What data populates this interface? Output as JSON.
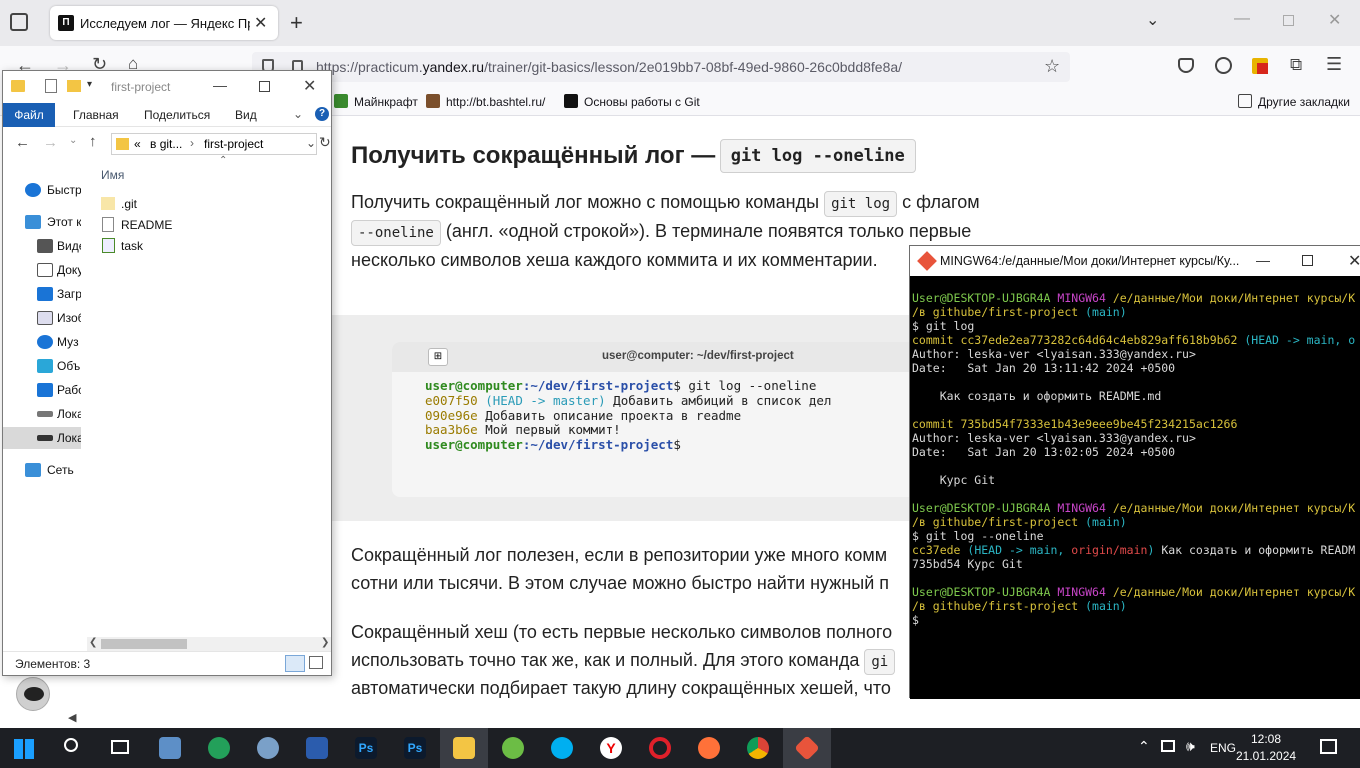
{
  "browser": {
    "tab_title": "Исследуем лог — Яндекс Практ",
    "url_prefix": "https://practicum.",
    "url_host": "yandex.ru",
    "url_path": "/trainer/git-basics/lesson/2e019bb7-08bf-49ed-9860-26c0bdd8fe8a/",
    "bookmarks": [
      "Майнкрафт",
      "http://bt.bashtel.ru/",
      "Основы работы с Git"
    ],
    "other_bookmarks": "Другие закладки"
  },
  "lesson": {
    "heading": "Получить сокращённый лог —",
    "heading_code": "git log --oneline",
    "p1_a": "Получить сокращённый лог можно с помощью команды",
    "p1_code1": "git log",
    "p1_b": "с флагом",
    "p1_code2": "--oneline",
    "p1_c": "(англ. «одной строкой»). В терминале появятся только первые",
    "p1_d": "несколько символов хеша каждого коммита и их комментарии.",
    "terminal_title": "user@computer: ~/dev/first-project",
    "term_prompt_user": "user@computer",
    "term_prompt_path": ":~/dev/first-project",
    "term_cmd": "$ git log --oneline",
    "term_l1_hash": "e007f50",
    "term_l1_ref": "(HEAD -> master)",
    "term_l1_msg": "Добавить амбиций в список дел",
    "term_l2_hash": "090e96e",
    "term_l2_msg": "Добавить описание проекта в readme",
    "term_l3_hash": "baa3b6e",
    "term_l3_msg": "Мой первый коммит!",
    "term_end": "$",
    "p2_a": "Сокращённый лог полезен, если в репозитории уже много комм",
    "p2_b": "сотни или тысячи. В этом случае можно быстро найти нужный п",
    "p3_a": "Сокращённый хеш (то есть первые несколько символов полного",
    "p3_b": "использовать точно так же, как и полный. Для этого команда",
    "p3_b_code": "gi",
    "p3_c": "автоматически подбирает такую длину сокращённых хешей, что"
  },
  "explorer": {
    "title": "first-project",
    "ribbon": [
      "Файл",
      "Главная",
      "Поделиться",
      "Вид"
    ],
    "address_prev": "«",
    "address_parts": [
      "в git...",
      "first-project"
    ],
    "column_name": "Имя",
    "nav": [
      "Быстр",
      "Этот к",
      "Виде",
      "Доку",
      "Загр",
      "Изоб",
      "Муз",
      "Объ",
      "Рабо",
      "Лока",
      "Лока",
      "Сеть"
    ],
    "files": [
      ".git",
      "README",
      "task"
    ],
    "status": "Элементов: 3"
  },
  "gitbash": {
    "title": "MINGW64:/e/данные/Мои доки/Интернет курсы/Ку...",
    "user": "User@DESKTOP-UJBGR4A",
    "env": "MINGW64",
    "path1": "/e/данные/Мои доки/Интернет курсы/К",
    "path2": "/в githube/first-project",
    "branch": "(main)",
    "cmd1": "$ git log",
    "c1_commit": "commit cc37ede2ea773282c64d64c4eb829aff618b9b62",
    "c1_head": "(HEAD -> main, o",
    "c1_author": "Author: leska-ver <lyaisan.333@yandex.ru>",
    "c1_date": "Date:   Sat Jan 20 13:11:42 2024 +0500",
    "c1_msg": "    Как создать и оформить README.md",
    "c2_commit": "commit 735bd54f7333e1b43e9eee9be45f234215ac1266",
    "c2_author": "Author: leska-ver <lyaisan.333@yandex.ru>",
    "c2_date": "Date:   Sat Jan 20 13:02:05 2024 +0500",
    "c2_msg": "    Курс Git",
    "cmd2": "$ git log --oneline",
    "o1_hash": "cc37ede",
    "o1_head": "(HEAD -> main,",
    "o1_origin": "origin/main",
    "o1_close": ")",
    "o1_msg": " Как создать и оформить READM",
    "o2": "735bd54 Курс Git",
    "prompt_end": "$"
  },
  "taskbar": {
    "lang": "ENG",
    "time": "12:08",
    "date": "21.01.2024"
  }
}
